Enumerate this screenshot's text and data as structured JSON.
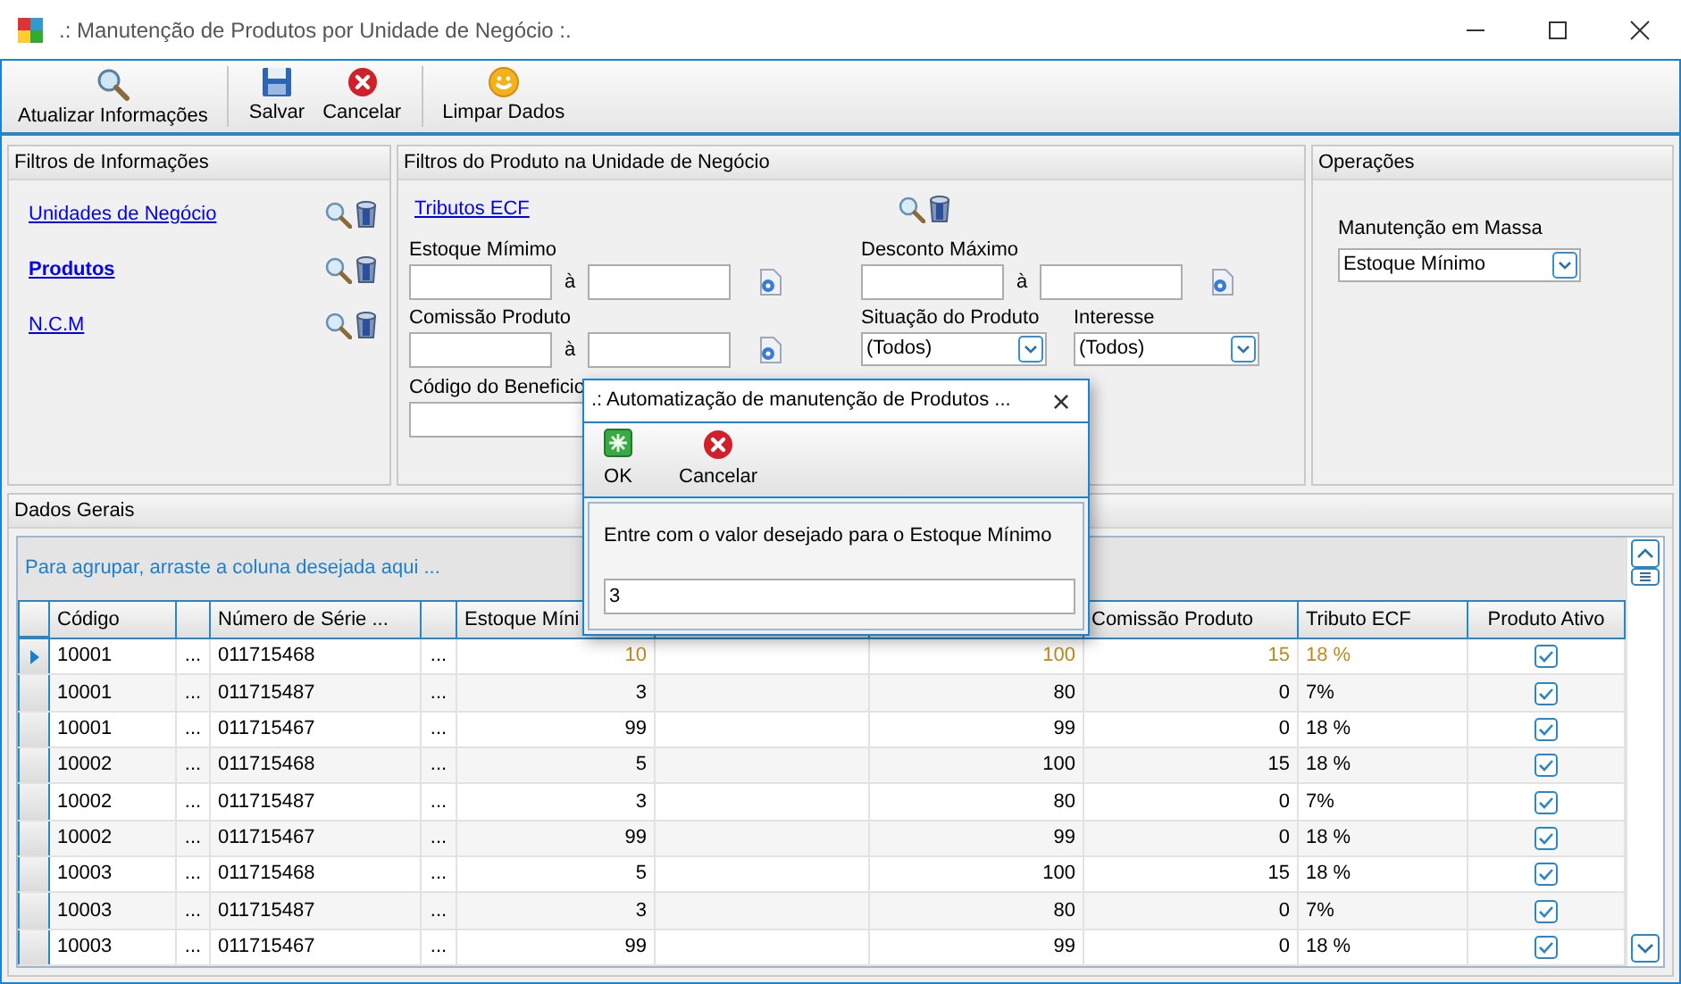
{
  "window": {
    "title": ".: Manutenção de Produtos por Unidade de Negócio :."
  },
  "toolbar": [
    {
      "label": "Atualizar Informações"
    },
    {
      "label": "Salvar"
    },
    {
      "label": "Cancelar"
    },
    {
      "label": "Limpar Dados"
    }
  ],
  "filtros_informacoes": {
    "title": "Filtros de Informações",
    "links": [
      {
        "label": "Unidades de Negócio",
        "bold": false
      },
      {
        "label": "Produtos",
        "bold": true
      },
      {
        "label": "N.C.M",
        "bold": false
      }
    ]
  },
  "filtros_produto": {
    "title": "Filtros do Produto na Unidade de Negócio",
    "link": "Tributos ECF",
    "ranges": [
      {
        "label": "Estoque Mímimo",
        "separator": "à"
      },
      {
        "label": "Comissão Produto",
        "separator": "à"
      },
      {
        "label": "Desconto Máximo",
        "separator": "à"
      }
    ],
    "codigo_beneficio": {
      "label": "Código do Beneficio"
    },
    "situacao": {
      "label": "Situação do Produto",
      "value": "(Todos)"
    },
    "interesse": {
      "label": "Interesse",
      "value": "(Todos)"
    }
  },
  "operacoes": {
    "title": "Operações",
    "label": "Manutenção em Massa",
    "value": "Estoque Mínimo"
  },
  "dados_gerais": {
    "title": "Dados Gerais",
    "group_hint": "Para agrupar, arraste a coluna desejada aqui ...",
    "columns": [
      {
        "kind": "text",
        "label": "Código"
      },
      {
        "kind": "button"
      },
      {
        "kind": "text",
        "label": "Número de Série ..."
      },
      {
        "kind": "button"
      },
      {
        "kind": "number",
        "label": "Estoque Míni"
      },
      {
        "kind": "number"
      },
      {
        "kind": "number"
      },
      {
        "kind": "number",
        "label": "Comissão Produto"
      },
      {
        "kind": "text",
        "label": "Tributo ECF"
      },
      {
        "kind": "check",
        "label": "Produto Ativo"
      }
    ],
    "rows": [
      {
        "selected": true,
        "codigo": "10001",
        "button_1": "...",
        "serie": "011715468",
        "button_2": "...",
        "estoque": "10",
        "column_7": "100",
        "comissao": "15",
        "tributo": "18 %",
        "ativo": true
      },
      {
        "selected": false,
        "codigo": "10001",
        "button_1": "...",
        "serie": "011715487",
        "button_2": "...",
        "estoque": "3",
        "column_7": "80",
        "comissao": "0",
        "tributo": "7%",
        "ativo": true
      },
      {
        "selected": false,
        "codigo": "10001",
        "button_1": "...",
        "serie": "011715467",
        "button_2": "...",
        "estoque": "99",
        "column_7": "99",
        "comissao": "0",
        "tributo": "18 %",
        "ativo": true
      },
      {
        "selected": false,
        "codigo": "10002",
        "button_1": "...",
        "serie": "011715468",
        "button_2": "...",
        "estoque": "5",
        "column_7": "100",
        "comissao": "15",
        "tributo": "18 %",
        "ativo": true
      },
      {
        "selected": false,
        "codigo": "10002",
        "button_1": "...",
        "serie": "011715487",
        "button_2": "...",
        "estoque": "3",
        "column_7": "80",
        "comissao": "0",
        "tributo": "7%",
        "ativo": true
      },
      {
        "selected": false,
        "codigo": "10002",
        "button_1": "...",
        "serie": "011715467",
        "button_2": "...",
        "estoque": "99",
        "column_7": "99",
        "comissao": "0",
        "tributo": "18 %",
        "ativo": true
      },
      {
        "selected": false,
        "codigo": "10003",
        "button_1": "...",
        "serie": "011715468",
        "button_2": "...",
        "estoque": "5",
        "column_7": "100",
        "comissao": "15",
        "tributo": "18 %",
        "ativo": true
      },
      {
        "selected": false,
        "codigo": "10003",
        "button_1": "...",
        "serie": "011715487",
        "button_2": "...",
        "estoque": "3",
        "column_7": "80",
        "comissao": "0",
        "tributo": "7%",
        "ativo": true
      },
      {
        "selected": false,
        "codigo": "10003",
        "button_1": "...",
        "serie": "011715467",
        "button_2": "...",
        "estoque": "99",
        "column_7": "99",
        "comissao": "0",
        "tributo": "18 %",
        "ativo": true
      }
    ]
  },
  "dialog": {
    "title": ".: Automatização de manutenção de Produtos ...",
    "close": "×",
    "buttons": [
      {
        "label": "OK"
      },
      {
        "label": "Cancelar"
      }
    ],
    "prompt": "Entre com o valor desejado para o Estoque Mínimo",
    "value": "3"
  }
}
